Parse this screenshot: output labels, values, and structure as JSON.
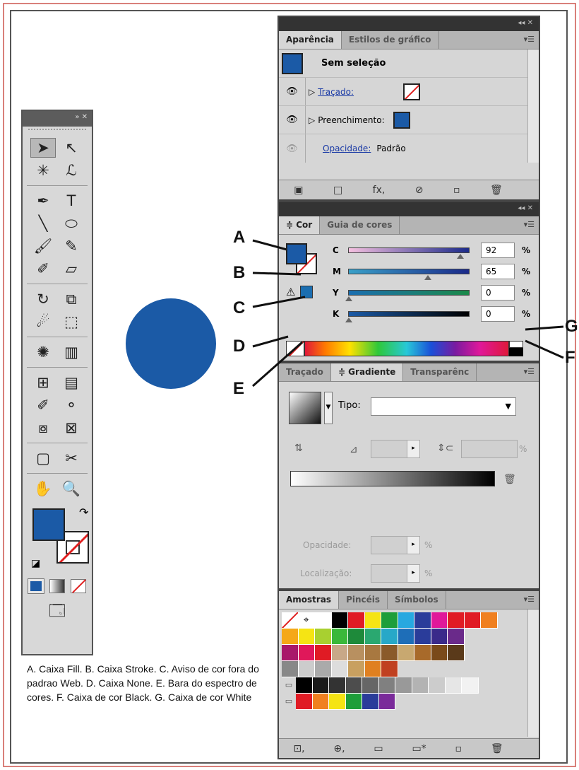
{
  "tools": {
    "header": "»  ✕",
    "rows": [
      [
        "selection-tool",
        "direct-selection-tool"
      ],
      [
        "magic-wand-tool",
        "lasso-tool"
      ],
      [
        "pen-tool",
        "type-tool"
      ],
      [
        "line-segment-tool",
        "ellipse-tool"
      ],
      [
        "paintbrush-tool",
        "pencil-tool"
      ],
      [
        "blob-brush-tool",
        "eraser-tool"
      ],
      [
        "rotate-tool",
        "scale-tool"
      ],
      [
        "warp-tool",
        "free-transform-tool"
      ],
      [
        "symbol-sprayer-tool",
        "column-graph-tool"
      ],
      [
        "mesh-tool",
        "gradient-tool"
      ],
      [
        "eyedropper-tool",
        "blend-tool"
      ],
      [
        "live-paint-bucket-tool",
        "live-paint-selection-tool"
      ],
      [
        "artboard-tool",
        "slice-tool"
      ],
      [
        "hand-tool",
        "zoom-tool"
      ]
    ],
    "glyphs": [
      "➤",
      "↖",
      "✳",
      "ℒ",
      "✒",
      "T",
      "╲",
      "⬭",
      "🖌",
      "✎",
      "✐",
      "▱",
      "↻",
      "⧉",
      "☄",
      "⬚",
      "✺",
      "▥",
      "⊞",
      "▤",
      "✐",
      "⚬",
      "⧇",
      "⊠",
      "▢",
      "✂",
      "✋",
      "🔍"
    ]
  },
  "appearance": {
    "top": "◂◂  ✕",
    "tabs": [
      "Aparência",
      "Estilos de gráfico"
    ],
    "title": "Sem seleção",
    "rows": [
      {
        "label": "Traçado:",
        "swatch": "none"
      },
      {
        "label": "Preenchimento:",
        "swatch": "blue"
      },
      {
        "label": "Opacidade:",
        "value": "Padrão"
      }
    ],
    "footer": [
      "▣",
      "□",
      "fx,",
      "⊘",
      "▫",
      "🗑"
    ]
  },
  "color": {
    "top": "◂◂  ✕",
    "tabs": [
      "≑ Cor",
      "Guia de cores"
    ],
    "sliders": [
      {
        "channel": "C",
        "value": "92",
        "pct": "%",
        "grad": [
          "#f5c0e0",
          "#1b2a8a"
        ],
        "pos": 0.92
      },
      {
        "channel": "M",
        "value": "65",
        "pct": "%",
        "grad": [
          "#3aa0c8",
          "#1b2a8a"
        ],
        "pos": 0.65
      },
      {
        "channel": "Y",
        "value": "0",
        "pct": "%",
        "grad": [
          "#1b6eb0",
          "#1b8a4a"
        ],
        "pos": 0
      },
      {
        "channel": "K",
        "value": "0",
        "pct": "%",
        "grad": [
          "#1b5aa6",
          "#000000"
        ],
        "pos": 0
      }
    ]
  },
  "gradient": {
    "tabs": [
      "Traçado",
      "≑ Gradiente",
      "Transparênc"
    ],
    "tipo_label": "Tipo:",
    "opacity_label": "Opacidade:",
    "location_label": "Localização:",
    "pct": "%"
  },
  "swatches": {
    "tabs": [
      "Amostras",
      "Pincéis",
      "Símbolos"
    ],
    "row1": [
      "#ffffff",
      "#000000",
      "#e01b24",
      "#f5e414",
      "#1e9e3a",
      "#27a8e0",
      "#2a3c9a",
      "#e0189a",
      "#e01b24",
      "#e01b24",
      "#f08020"
    ],
    "row2": [
      "#f5a818",
      "#f5e414",
      "#a8d030",
      "#3ab83a",
      "#1e8a3a",
      "#2aa870",
      "#27a8c8",
      "#1e6eb8",
      "#2a3c9a",
      "#3a2a8a",
      "#6a2a8a"
    ],
    "row3": [
      "#a8186a",
      "#e0185a",
      "#e01b24",
      "#c8a888",
      "#b89060",
      "#a87840",
      "#8a5a2a",
      "#c8a870",
      "#a86a2a",
      "#7a4a1a",
      "#5a3a1a"
    ],
    "row4": [
      "#888888",
      "#cccccc",
      "#aaaaaa",
      "#dddddd",
      "#c8a060",
      "#e08020",
      "#c04020"
    ],
    "row5": [
      "#000000",
      "#1a1a1a",
      "#333333",
      "#4d4d4d",
      "#666666",
      "#808080",
      "#999999",
      "#b3b3b3",
      "#cccccc",
      "#e6e6e6",
      "#f2f2f2"
    ],
    "row6": [
      "#e01b24",
      "#f08020",
      "#f5e414",
      "#1e9e3a",
      "#2a3c9a",
      "#7a2a9a"
    ],
    "footer": [
      "⊡,",
      "⊕,",
      "▭",
      "▭*",
      "▫",
      "🗑"
    ]
  },
  "callouts": [
    "A",
    "B",
    "C",
    "D",
    "E",
    "F",
    "G"
  ],
  "caption": "A. Caixa Fill. B. Caixa Stroke. C. Aviso de cor fora do padrao Web. D. Caixa None. E. Bara do espectro de cores. F. Caixa de cor Black. G. Caixa de cor White",
  "colors": {
    "fill": "#1b5aa6",
    "panel": "#d6d6d6",
    "header": "#333333"
  }
}
